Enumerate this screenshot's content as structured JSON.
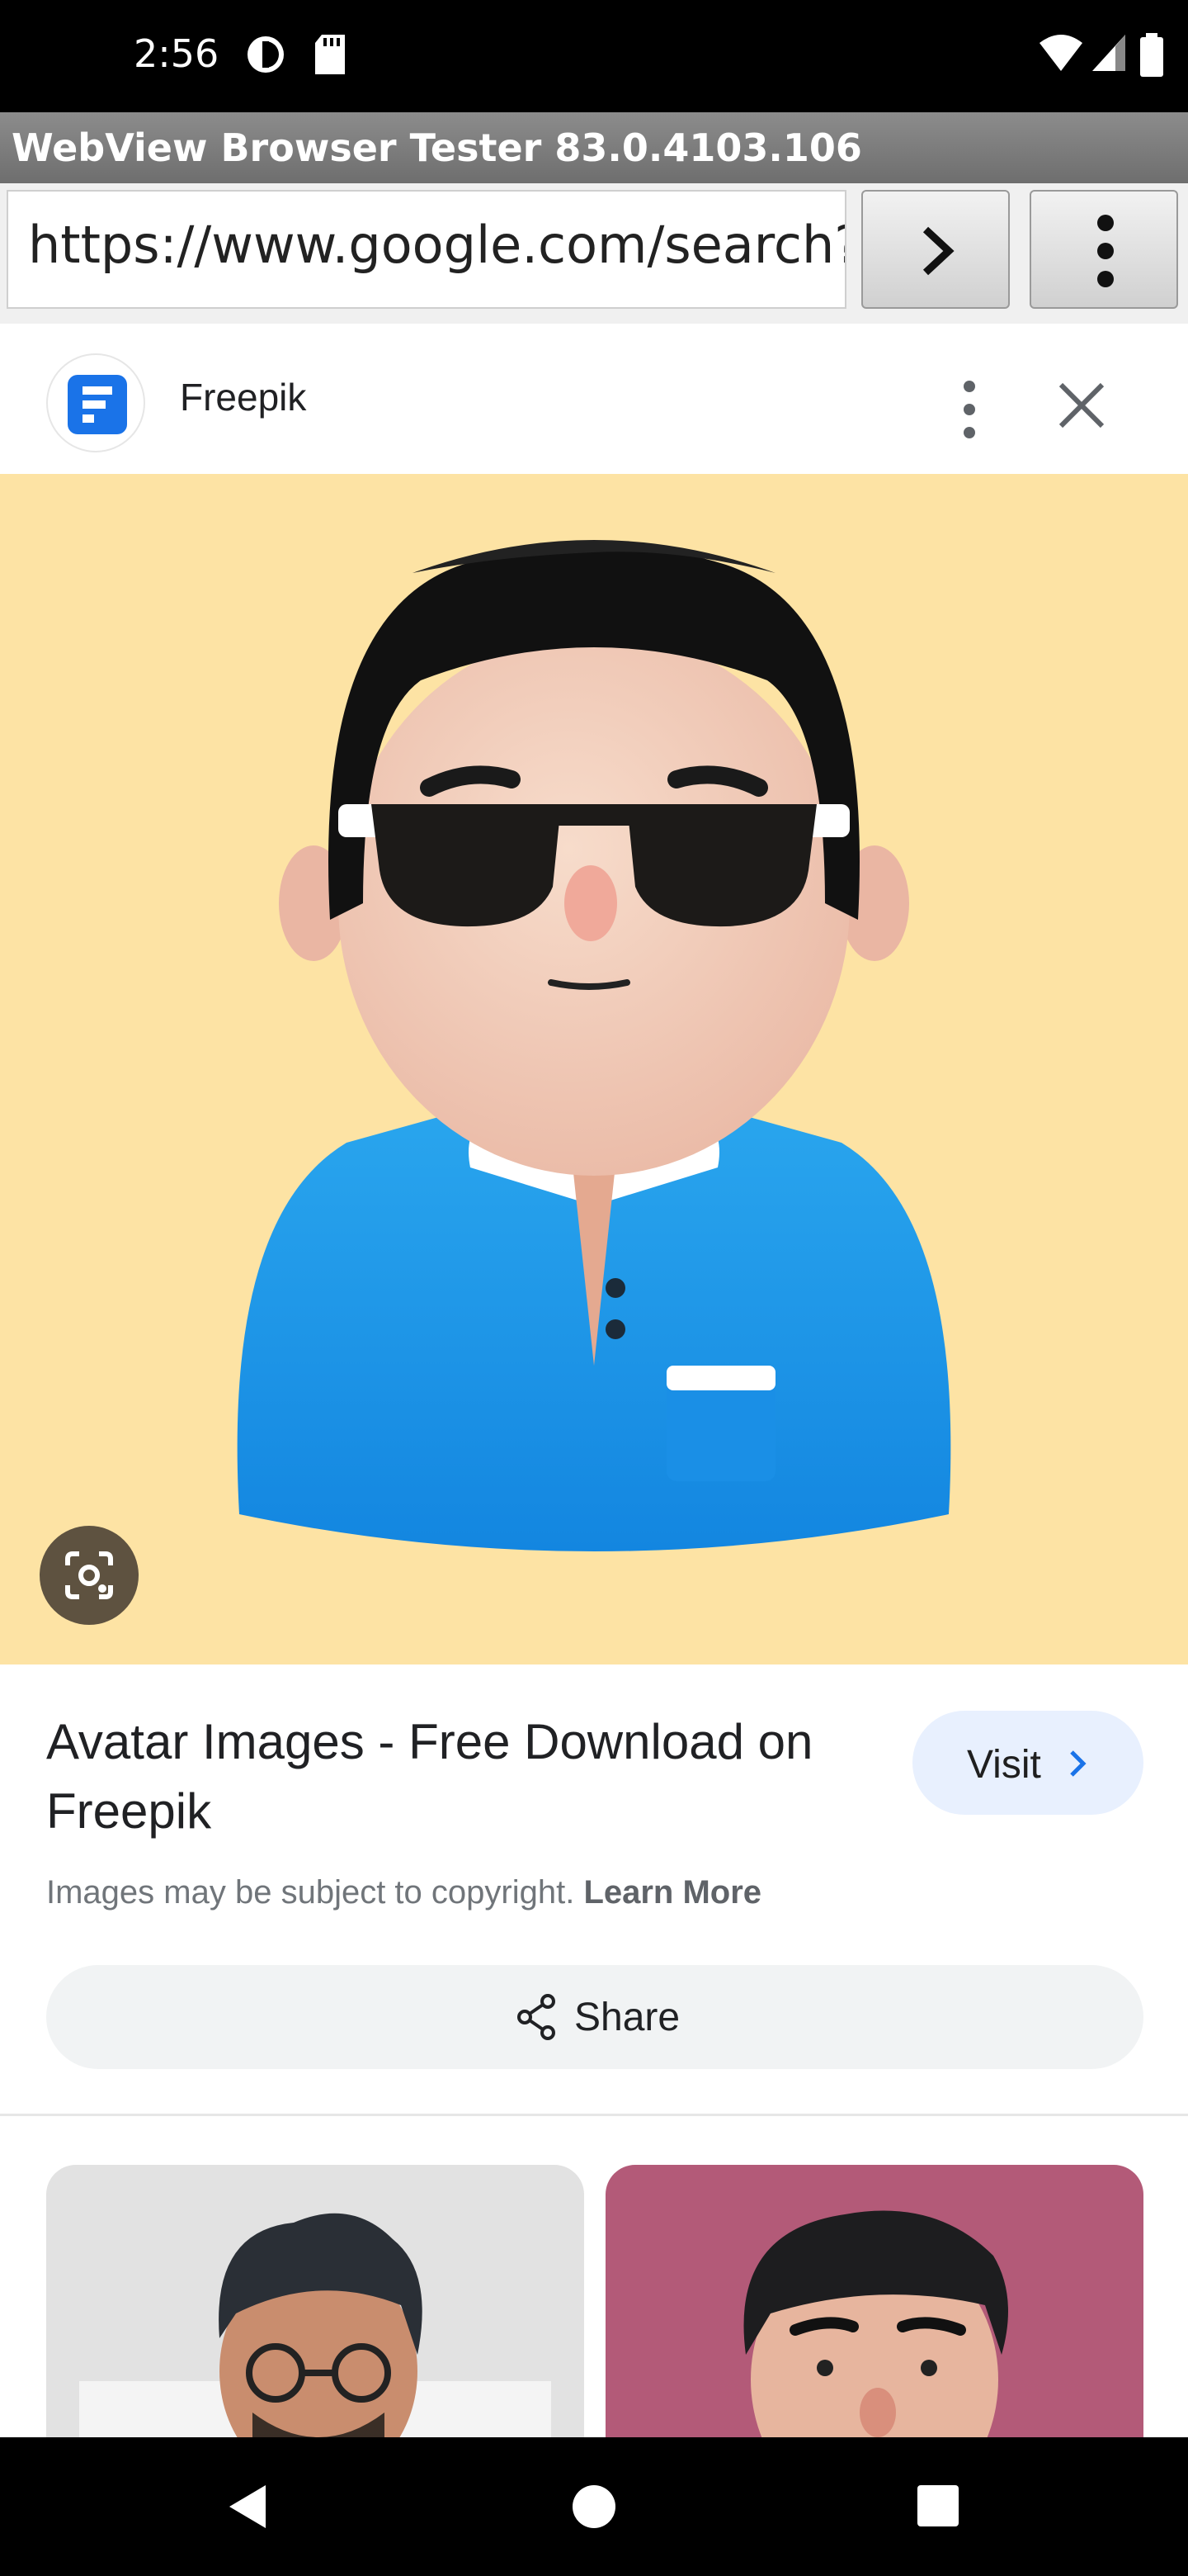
{
  "status_bar": {
    "time": "2:56",
    "icons": [
      "data-saver-icon",
      "sd-card-icon",
      "wifi-icon",
      "cell-signal-icon",
      "battery-icon"
    ]
  },
  "app": {
    "title": "WebView Browser Tester 83.0.4103.106",
    "url": "https://www.google.com/search?s",
    "go_icon": "chevron-right-icon",
    "menu_icon": "more-vert-icon"
  },
  "card": {
    "source_name": "Freepik",
    "more_icon": "more-vert-icon",
    "close_icon": "close-icon"
  },
  "result": {
    "title": "Avatar Images - Free Download on Freepik",
    "visit_label": "Visit",
    "copyright_text": "Images may be subject to copyright.",
    "learn_more": "Learn More",
    "share_label": "Share"
  },
  "colors": {
    "hero_background": "#fde3a4",
    "visit_button": "#e8f0fe",
    "share_button": "#f1f3f4",
    "brand_blue": "#1a73e8",
    "thumb_left": "#e2e2e2",
    "thumb_right": "#b35a78"
  },
  "nav_bar": {
    "icons": [
      "back-icon",
      "home-icon",
      "recents-icon"
    ]
  }
}
